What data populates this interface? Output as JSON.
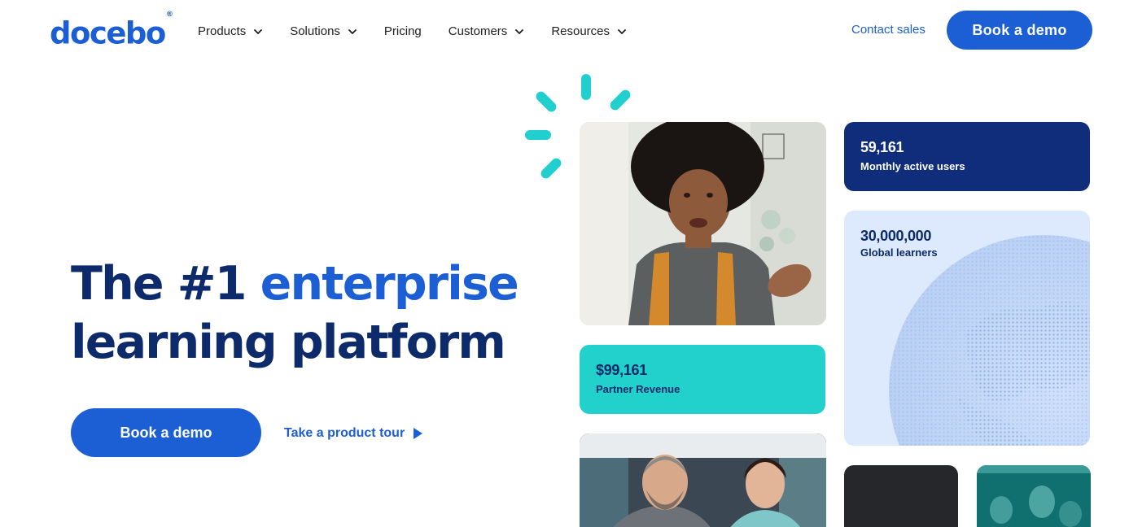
{
  "brand": {
    "logo_text": "docebo",
    "logo_mark": "®",
    "primary": "#1c5fd4",
    "navy": "#0d2a6b",
    "teal": "#22d1cc"
  },
  "nav": {
    "items": [
      {
        "label": "Products",
        "has_dropdown": true
      },
      {
        "label": "Solutions",
        "has_dropdown": true
      },
      {
        "label": "Pricing",
        "has_dropdown": false
      },
      {
        "label": "Customers",
        "has_dropdown": true
      },
      {
        "label": "Resources",
        "has_dropdown": true
      }
    ],
    "contact_label": "Contact sales",
    "demo_label": "Book a demo"
  },
  "hero": {
    "headline_part1": "The #1 ",
    "headline_accent": "enterprise",
    "headline_part2": "learning platform",
    "demo_label": "Book a demo",
    "tour_label": "Take a product tour"
  },
  "stats": {
    "users": {
      "value": "59,161",
      "label": "Monthly active users"
    },
    "learners": {
      "value": "30,000,000",
      "label": "Global learners"
    },
    "revenue": {
      "value": "$99,161",
      "label": "Partner Revenue"
    }
  },
  "icons": {
    "dropdown": "chevron-down-icon",
    "tour": "play-icon",
    "sparkle": "sparkle-burst-icon",
    "globe": "globe-illustration"
  }
}
